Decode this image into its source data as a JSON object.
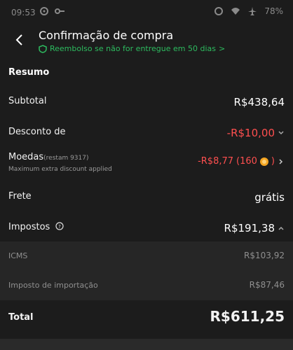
{
  "status_bar": {
    "time": "09:53",
    "battery": "78%"
  },
  "header": {
    "title": "Confirmação de compra",
    "refund_text": "Reembolso se não for entregue em 50 dias",
    "refund_arrow": ">"
  },
  "summary": {
    "title": "Resumo",
    "subtotal": {
      "label": "Subtotal",
      "value": "R$438,64"
    },
    "discount": {
      "label": "Desconto de",
      "value": "-R$10,00"
    },
    "coins": {
      "label": "Moedas",
      "remaining": "(restam 9317)",
      "note": "Maximum extra discount applied",
      "value": "-R$8,77",
      "coin_count": "(160",
      "coin_close": ")"
    },
    "shipping": {
      "label": "Frete",
      "value": "grátis"
    },
    "taxes": {
      "label": "Impostos",
      "value": "R$191,38",
      "items": [
        {
          "label": "ICMS",
          "value": "R$103,92"
        },
        {
          "label": "Imposto de importação",
          "value": "R$87,46"
        }
      ]
    },
    "total": {
      "label": "Total",
      "value": "R$611,25"
    }
  },
  "colors": {
    "accent_green": "#2dbb5f",
    "discount_red": "#ff4f4f",
    "coin_orange": "#f5a623"
  }
}
